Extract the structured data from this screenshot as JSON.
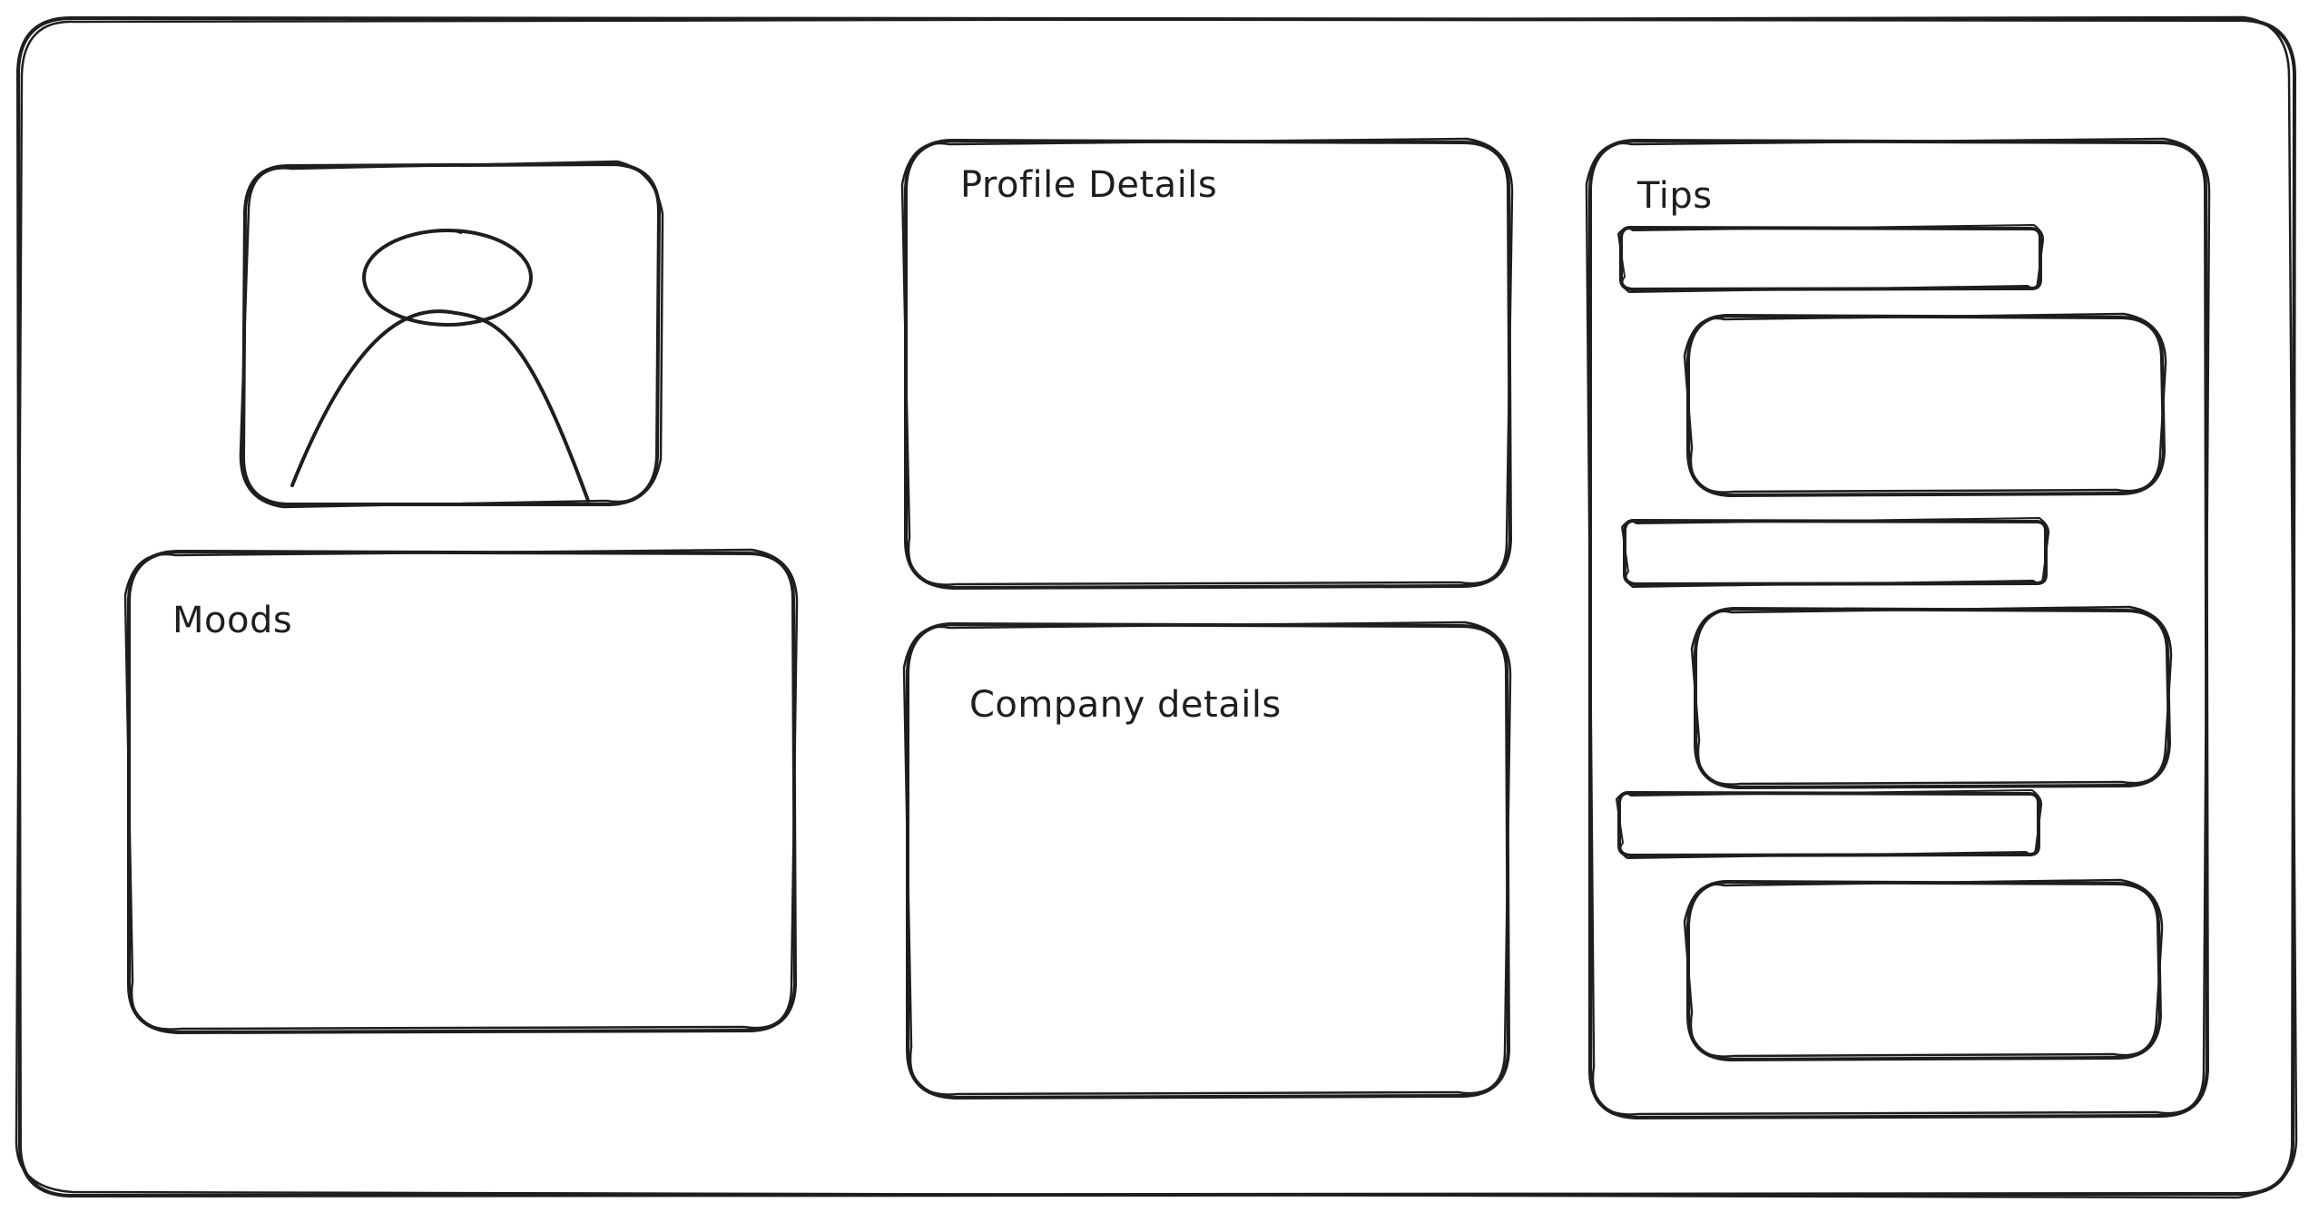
{
  "panels": {
    "moods": {
      "title": "Moods"
    },
    "profile_details": {
      "title": "Profile Details"
    },
    "company_details": {
      "title": "Company details"
    },
    "tips": {
      "title": "Tips"
    }
  },
  "avatar": {
    "icon": "user-icon"
  },
  "colors": {
    "stroke": "#1e1e1e",
    "background": "#ffffff"
  }
}
